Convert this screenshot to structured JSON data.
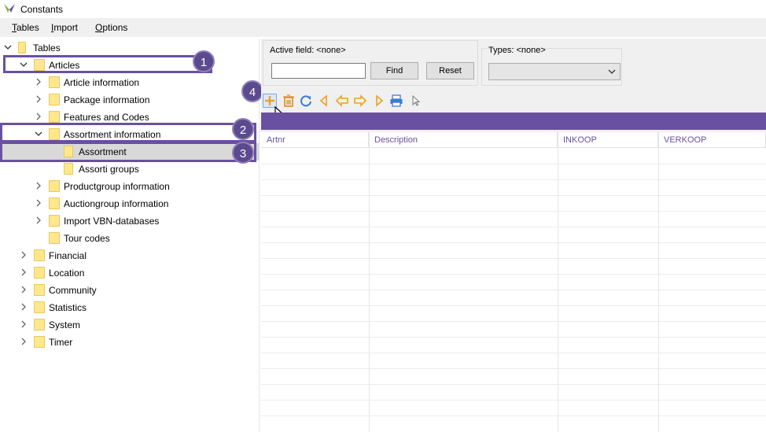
{
  "window": {
    "title": "Constants"
  },
  "menu": {
    "tables": "Tables",
    "import": "Import",
    "options": "Options"
  },
  "tree": {
    "root": "Tables",
    "articles": "Articles",
    "article_information": "Article information",
    "package_information": "Package information",
    "features_and_codes": "Features and Codes",
    "assortment_information": "Assortment information",
    "assortment": "Assortment",
    "assorti_groups": "Assorti groups",
    "productgroup_information": "Productgroup information",
    "auctiongroup_information": "Auctiongroup information",
    "import_vbn": "Import VBN-databases",
    "tour_codes": "Tour codes",
    "financial": "Financial",
    "location": "Location",
    "community": "Community",
    "statistics": "Statistics",
    "system": "System",
    "timer": "Timer"
  },
  "callouts": {
    "c1": "1",
    "c2": "2",
    "c3": "3",
    "c4": "4"
  },
  "filter": {
    "active_field_label": "Active field: <none>",
    "search_value": "",
    "find": "Find",
    "reset": "Reset",
    "types_label": "Types: <none>",
    "types_value": ""
  },
  "toolbar_icons": [
    "add-icon",
    "delete-icon",
    "refresh-icon",
    "first-icon",
    "prev-icon",
    "next-icon",
    "last-icon",
    "print-icon",
    "pointer-icon"
  ],
  "grid": {
    "columns": [
      "Artnr",
      "Description",
      "INKOOP",
      "VERKOOP"
    ]
  },
  "colors": {
    "accent": "#6a50a0",
    "folder": "#ffe88c",
    "icon_orange": "#f0a020",
    "icon_blue": "#3a7bd5"
  }
}
